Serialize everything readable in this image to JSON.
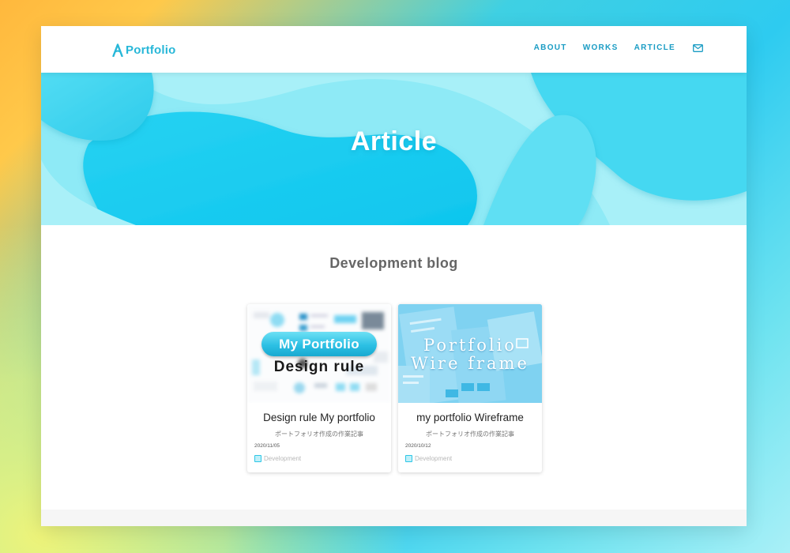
{
  "brand": {
    "logo_text": "Portfolio",
    "accent": "#27b7d8"
  },
  "nav": {
    "items": [
      "ABOUT",
      "WORKS",
      "ARTICLE"
    ],
    "contact_icon": "mail-icon"
  },
  "hero": {
    "title": "Article"
  },
  "section": {
    "title": "Development blog"
  },
  "cards": [
    {
      "thumb_pill": "My Portfolio",
      "thumb_text": "Design rule",
      "title": "Design rule My portfolio",
      "subtitle": "ポートフォリオ作成の作業記事",
      "date": "2020/11/05",
      "tag": "Development"
    },
    {
      "thumb_line1": "Portfolio",
      "thumb_line2": "Wire frame",
      "title": "my portfolio Wireframe",
      "subtitle": "ポートフォリオ作成の作業記事",
      "date": "2020/10/12",
      "tag": "Development"
    }
  ]
}
